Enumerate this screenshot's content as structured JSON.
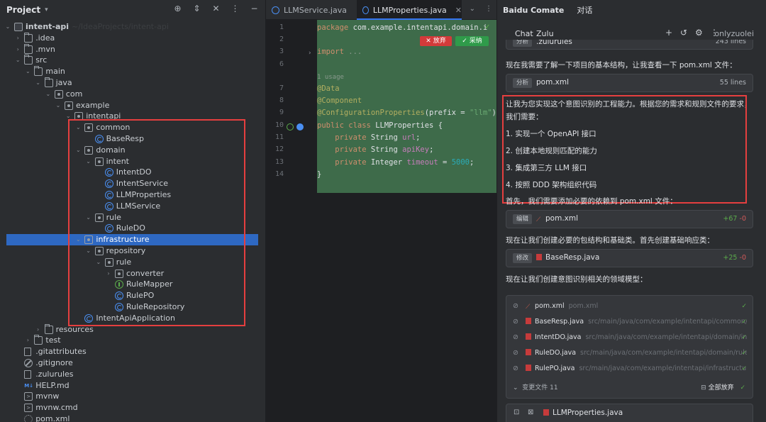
{
  "project": {
    "title": "Project",
    "tree": [
      {
        "id": "intent-api",
        "label": "intent-api",
        "icon": "root",
        "depth": 0,
        "open": true,
        "path": "~/IdeaProjects/intent-api"
      },
      {
        "id": "idea",
        "label": ".idea",
        "icon": "folder",
        "depth": 1,
        "open": false
      },
      {
        "id": "mvn",
        "label": ".mvn",
        "icon": "folder",
        "depth": 1,
        "open": false
      },
      {
        "id": "src",
        "label": "src",
        "icon": "folder",
        "depth": 1,
        "open": true
      },
      {
        "id": "main",
        "label": "main",
        "icon": "folder",
        "depth": 2,
        "open": true
      },
      {
        "id": "java",
        "label": "java",
        "icon": "folder",
        "depth": 3,
        "open": true
      },
      {
        "id": "com",
        "label": "com",
        "icon": "pkg",
        "depth": 4,
        "open": true
      },
      {
        "id": "example",
        "label": "example",
        "icon": "pkg",
        "depth": 5,
        "open": true
      },
      {
        "id": "intentapi",
        "label": "intentapi",
        "icon": "pkg",
        "depth": 6,
        "open": true
      },
      {
        "id": "common",
        "label": "common",
        "icon": "pkg",
        "depth": 7,
        "open": true
      },
      {
        "id": "baseresp",
        "label": "BaseResp",
        "icon": "cls",
        "depth": 8
      },
      {
        "id": "domain",
        "label": "domain",
        "icon": "pkg",
        "depth": 7,
        "open": true
      },
      {
        "id": "intent",
        "label": "intent",
        "icon": "pkg",
        "depth": 8,
        "open": true
      },
      {
        "id": "intentdo",
        "label": "IntentDO",
        "icon": "cls",
        "depth": 9
      },
      {
        "id": "intentservice",
        "label": "IntentService",
        "icon": "cls",
        "depth": 9
      },
      {
        "id": "llmproperties",
        "label": "LLMProperties",
        "icon": "cls",
        "depth": 9
      },
      {
        "id": "llmservice",
        "label": "LLMService",
        "icon": "cls",
        "depth": 9
      },
      {
        "id": "rule",
        "label": "rule",
        "icon": "pkg",
        "depth": 8,
        "open": true
      },
      {
        "id": "ruledo",
        "label": "RuleDO",
        "icon": "cls",
        "depth": 9
      },
      {
        "id": "infrastructure",
        "label": "infrastructure",
        "icon": "pkg",
        "depth": 7,
        "open": true,
        "selected": true
      },
      {
        "id": "repository",
        "label": "repository",
        "icon": "pkg",
        "depth": 8,
        "open": true
      },
      {
        "id": "rule2",
        "label": "rule",
        "icon": "pkg",
        "depth": 9,
        "open": true
      },
      {
        "id": "converter",
        "label": "converter",
        "icon": "pkg",
        "depth": 10,
        "open": false
      },
      {
        "id": "rulemapper",
        "label": "RuleMapper",
        "icon": "iface",
        "depth": 10
      },
      {
        "id": "rulepo",
        "label": "RulePO",
        "icon": "cls",
        "depth": 10
      },
      {
        "id": "rulerepository",
        "label": "RuleRepository",
        "icon": "cls",
        "depth": 10
      },
      {
        "id": "intentapiapplication",
        "label": "IntentApiApplication",
        "icon": "cls",
        "depth": 7
      },
      {
        "id": "resources",
        "label": "resources",
        "icon": "folder",
        "depth": 3,
        "open": false
      },
      {
        "id": "test",
        "label": "test",
        "icon": "folder",
        "depth": 2,
        "open": false
      },
      {
        "id": "gitattributes",
        "label": ".gitattributes",
        "icon": "file",
        "depth": 1
      },
      {
        "id": "gitignore",
        "label": ".gitignore",
        "icon": "ban",
        "depth": 1
      },
      {
        "id": "zulurules",
        "label": ".zulurules",
        "icon": "file",
        "depth": 1
      },
      {
        "id": "helpmd",
        "label": "HELP.md",
        "icon": "md",
        "depth": 1
      },
      {
        "id": "mvnw",
        "label": "mvnw",
        "icon": "term",
        "depth": 1
      },
      {
        "id": "mvnwcmd",
        "label": "mvnw.cmd",
        "icon": "term",
        "depth": 1
      },
      {
        "id": "pomxml",
        "label": "pom.xml",
        "icon": "gear",
        "depth": 1
      }
    ]
  },
  "editor": {
    "tabs": [
      {
        "label": "LLMService.java",
        "active": false
      },
      {
        "label": "LLMProperties.java",
        "active": true
      }
    ],
    "reject_label": "✕ 放弃",
    "accept_label": "✓ 采纳",
    "usage_label": "1 usage",
    "lines": [
      {
        "num": "1",
        "html": "<span class='kw'>package </span><span class='cn'>com.example.intentapi.domain.i</span>"
      },
      {
        "num": "2",
        "html": ""
      },
      {
        "num": "3",
        "html": "<span class='kw'>import </span><span class='dim'>...</span>"
      },
      {
        "num": "6",
        "html": ""
      },
      {
        "num": "",
        "html": ""
      },
      {
        "num": "7",
        "html": "<span class='ann'>@Data</span>"
      },
      {
        "num": "8",
        "html": "<span class='ann'>@Component</span>"
      },
      {
        "num": "9",
        "html": "<span class='ann'>@ConfigurationProperties</span><span class='cn'>(prefix = </span><span class='str'>\"llm\"</span><span class='cn'>)</span>"
      },
      {
        "num": "10",
        "html": "<span class='kw'>public class </span><span class='cn'>LLMProperties {</span>"
      },
      {
        "num": "11",
        "html": "    <span class='kw'>private </span><span class='cn'>String </span><span class='fld'>url</span><span class='cn'>;</span>"
      },
      {
        "num": "12",
        "html": "    <span class='kw'>private </span><span class='cn'>String </span><span class='fld'>apiKey</span><span class='cn'>;</span>"
      },
      {
        "num": "13",
        "html": "    <span class='kw'>private </span><span class='cn'>Integer </span><span class='fld'>timeout</span><span class='cn'> = </span><span class='num'>5000</span><span class='cn'>;</span>"
      },
      {
        "num": "14",
        "html": "<span class='cn'>}</span>"
      }
    ]
  },
  "chat": {
    "tab_main": "Baidu Comate",
    "tab_dialog": "对话",
    "header_chat": "Chat",
    "header_zulu": "Zulu",
    "user": "onlyzuolei",
    "top_card": {
      "badge": "分析",
      "name": ".zulurules",
      "right": "243 lines"
    },
    "msg1": "现在我需要了解一下项目的基本结构，让我查看一下 pom.xml 文件：",
    "pom_card": {
      "badge": "分析",
      "name": "pom.xml",
      "right": "55 lines"
    },
    "plan_intro1": "让我为您实现这个意图识别的工程能力。根据您的需求和规则文件的要求，",
    "plan_intro2": "我们需要：",
    "plan_items": [
      "1. 实现一个 OpenAPI 接口",
      "2. 创建本地规则匹配的能力",
      "3. 集成第三方 LLM 接口",
      "4. 按照 DDD 架构组织代码"
    ],
    "msg2": "首先，我们需要添加必要的依赖到 pom.xml 文件：",
    "edit_card": {
      "badge": "编辑",
      "name": "pom.xml",
      "plus": "+67",
      "minus": "-0"
    },
    "msg3": "现在让我们创建必要的包结构和基础类。首先创建基础响应类：",
    "modify_card": {
      "badge": "修改",
      "name": "BaseResp.java",
      "plus": "+25",
      "minus": "-0"
    },
    "msg4": "现在让我们创建意图识别相关的领域模型：",
    "files": [
      {
        "name": "pom.xml",
        "path": "pom.xml",
        "kind": "xml"
      },
      {
        "name": "BaseResp.java",
        "path": "src/main/java/com/example/intentapi/common/B...",
        "kind": "java"
      },
      {
        "name": "IntentDO.java",
        "path": "src/main/java/com/example/intentapi/domain/inte...",
        "kind": "java"
      },
      {
        "name": "RuleDO.java",
        "path": "src/main/java/com/example/intentapi/domain/rule/R...",
        "kind": "java"
      },
      {
        "name": "RulePO.java",
        "path": "src/main/java/com/example/intentapi/infrastructure...",
        "kind": "java"
      }
    ],
    "changed_files": "变更文件 11",
    "discard_all": "全部放弃",
    "bottom_file": "LLMProperties.java"
  }
}
